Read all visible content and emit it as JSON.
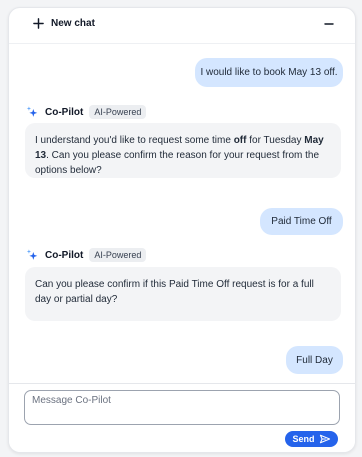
{
  "header": {
    "new_chat_label": "New chat"
  },
  "messages": [
    {
      "role": "user",
      "text": "I would like to book May 13 off."
    },
    {
      "role": "assistant",
      "assistant_name": "Co-Pilot",
      "badge": "AI-Powered",
      "text_parts": {
        "p1": "I understand you'd like to request some time ",
        "p2": "off",
        "p3": " for Tuesday ",
        "p4": "May 13",
        "p5": ". Can you please confirm the reason for your request from the options below?"
      }
    },
    {
      "role": "user",
      "text": "Paid Time Off"
    },
    {
      "role": "assistant",
      "assistant_name": "Co-Pilot",
      "badge": "AI-Powered",
      "text": "Can you please confirm if this Paid Time Off request is for a full day or partial day?"
    },
    {
      "role": "user",
      "text": "Full Day"
    }
  ],
  "composer": {
    "placeholder": "Message Co-Pilot",
    "send_label": "Send"
  },
  "colors": {
    "user_bubble": "#d4e6ff",
    "assistant_bubble": "#f3f4f6",
    "accent": "#2563eb"
  },
  "icons": {
    "new_chat": "plus-icon",
    "minimize": "minus-icon",
    "assistant": "sparkle-icon",
    "send": "send-arrow-icon"
  }
}
